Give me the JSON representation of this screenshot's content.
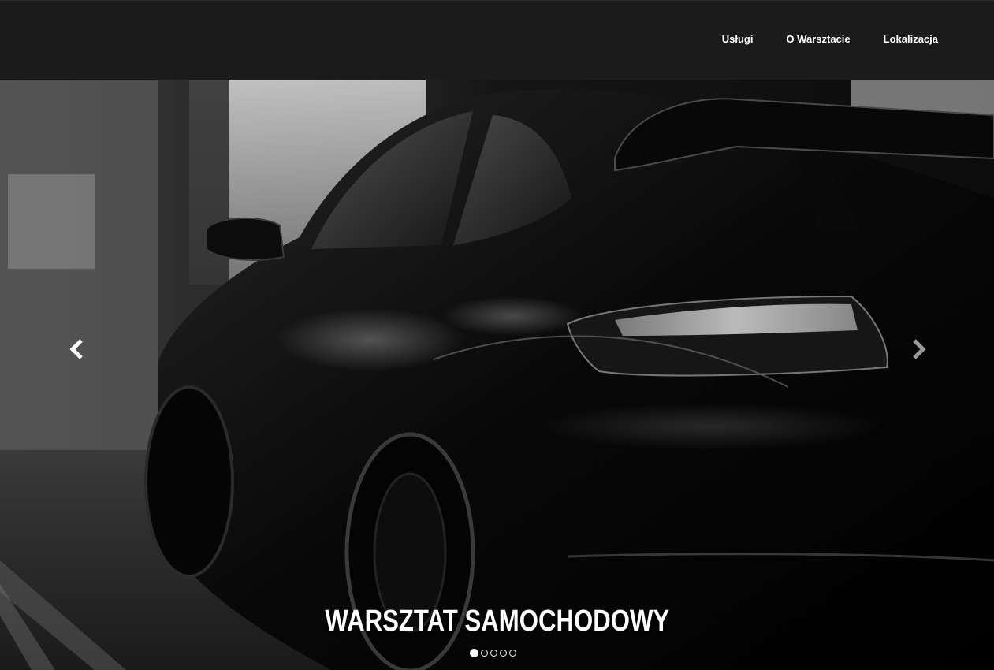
{
  "navbar": {
    "links": [
      {
        "label": "Usługi"
      },
      {
        "label": "O Warsztacie"
      },
      {
        "label": "Lokalizacja"
      }
    ]
  },
  "hero": {
    "image": "black-sports-car-rear-view",
    "caption": "WARSZTAT SAMOCHODOWY",
    "slide_count": 5,
    "active_slide": 1,
    "prev_icon": "chevron-left-icon",
    "next_icon": "chevron-right-icon"
  },
  "colors": {
    "navbar_bg": "#1b1b1b",
    "text": "#ffffff"
  }
}
